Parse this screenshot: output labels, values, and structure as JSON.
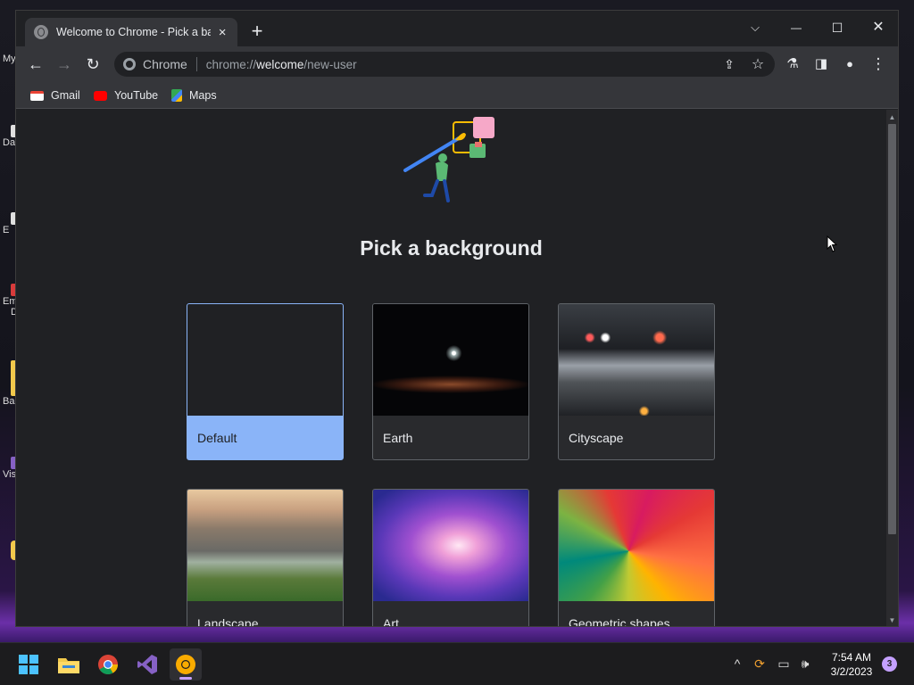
{
  "desktop": {
    "icons": [
      {
        "label": "My",
        "color": "#f2c94c"
      },
      {
        "label": "Da",
        "color": "#e0e0e0"
      },
      {
        "label": "E",
        "color": "#e0e0e0"
      },
      {
        "label": "Em",
        "color": "#d83b3b"
      },
      {
        "label": "D",
        "color": "#e0e0e0"
      },
      {
        "label": "Ba",
        "color": "#f2c94c"
      },
      {
        "label": "Vis",
        "color": "#8661c5"
      }
    ]
  },
  "tab": {
    "title": "Welcome to Chrome - Pick a background",
    "close": "×",
    "new_tab": "+"
  },
  "window_controls": {
    "menu": "⌵",
    "minimize": "—",
    "maximize": "☐",
    "close": "✕"
  },
  "toolbar": {
    "back": "←",
    "forward": "→",
    "reload": "↻",
    "scheme_label": "Chrome",
    "url_prefix": "chrome://",
    "url_host": "welcome",
    "url_path": "/new-user",
    "share_icon": "⇪",
    "star_icon": "☆",
    "labs_icon": "⚗",
    "sidepanel_icon": "◨",
    "profile_icon": "●",
    "menu_icon": "⋮"
  },
  "bookmarks": [
    {
      "label": "Gmail",
      "color": "#ea4335"
    },
    {
      "label": "YouTube",
      "color": "#ff0000"
    },
    {
      "label": "Maps",
      "color": "#34a853"
    }
  ],
  "page": {
    "heading": "Pick a background",
    "cards": [
      {
        "label": "Default",
        "selected": true
      },
      {
        "label": "Earth"
      },
      {
        "label": "Cityscape"
      },
      {
        "label": "Landscape"
      },
      {
        "label": "Art"
      },
      {
        "label": "Geometric shapes"
      }
    ]
  },
  "taskbar": {
    "time": "7:54 AM",
    "date": "3/2/2023",
    "notification_count": "3",
    "tray": {
      "chevron": "^",
      "sync": "⟳",
      "network": "▭",
      "volume": "🕪"
    }
  }
}
